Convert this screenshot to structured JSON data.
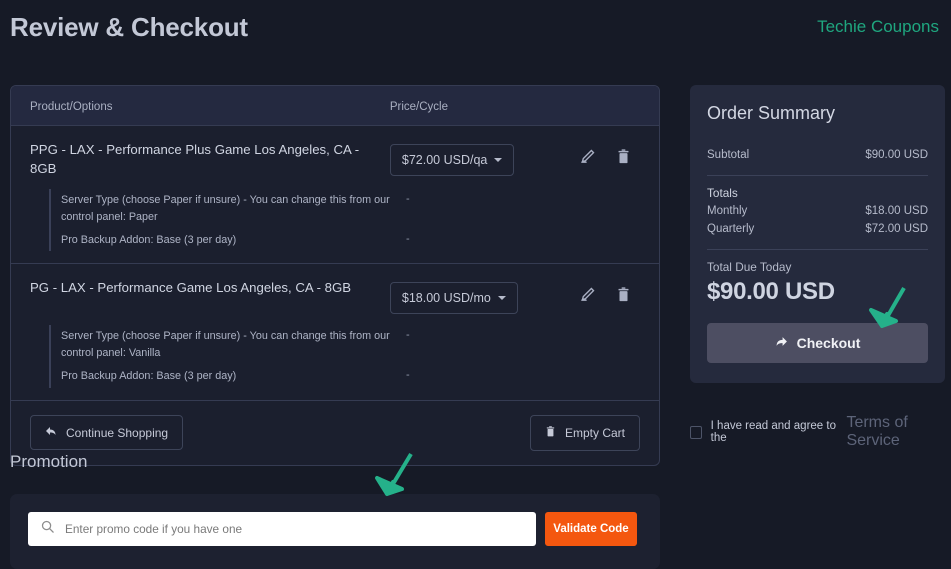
{
  "header": {
    "title": "Review & Checkout",
    "brand": "Techie Coupons",
    "brand_color": "#1fa67f"
  },
  "cart": {
    "columns": {
      "product": "Product/Options",
      "price": "Price/Cycle"
    },
    "rows": [
      {
        "name": "PPG - LAX - Performance Plus Game Los Angeles, CA - 8GB",
        "price": "$72.00 USD/qa",
        "edit_icon": "pencil-icon",
        "delete_icon": "trash-icon",
        "options": [
          {
            "label": "Server Type (choose Paper if unsure) - You can change this from our control panel: Paper",
            "value": "-"
          },
          {
            "label": "Pro Backup Addon: Base (3 per day)",
            "value": "-"
          }
        ]
      },
      {
        "name": "PG - LAX - Performance Game Los Angeles, CA - 8GB",
        "price": "$18.00 USD/mo",
        "edit_icon": "pencil-icon",
        "delete_icon": "trash-icon",
        "options": [
          {
            "label": "Server Type (choose Paper if unsure) - You can change this from our control panel: Vanilla",
            "value": "-"
          },
          {
            "label": "Pro Backup Addon: Base (3 per day)",
            "value": "-"
          }
        ]
      }
    ],
    "continue_shopping": "Continue Shopping",
    "empty_cart": "Empty Cart"
  },
  "summary": {
    "title": "Order Summary",
    "subtotal_label": "Subtotal",
    "subtotal_value": "$90.00 USD",
    "totals_label": "Totals",
    "totals": [
      {
        "label": "Monthly",
        "value": "$18.00 USD"
      },
      {
        "label": "Quarterly",
        "value": "$72.00 USD"
      }
    ],
    "total_due_label": "Total Due Today",
    "total_due_value": "$90.00 USD",
    "checkout_label": "Checkout",
    "checkout_color": "#4d4e62"
  },
  "terms": {
    "text": "I have read and agree to the",
    "link": "Terms of Service",
    "checked": false
  },
  "promotion": {
    "title": "Promotion",
    "placeholder": "Enter promo code if you have one",
    "value": "",
    "button": "Validate Code",
    "button_color": "#f4570f",
    "search_icon": "search-icon"
  },
  "annotations": {
    "color": "#25b18a",
    "arrows": [
      "arrow-pointing-to-promo-field",
      "arrow-pointing-to-total-due"
    ]
  }
}
